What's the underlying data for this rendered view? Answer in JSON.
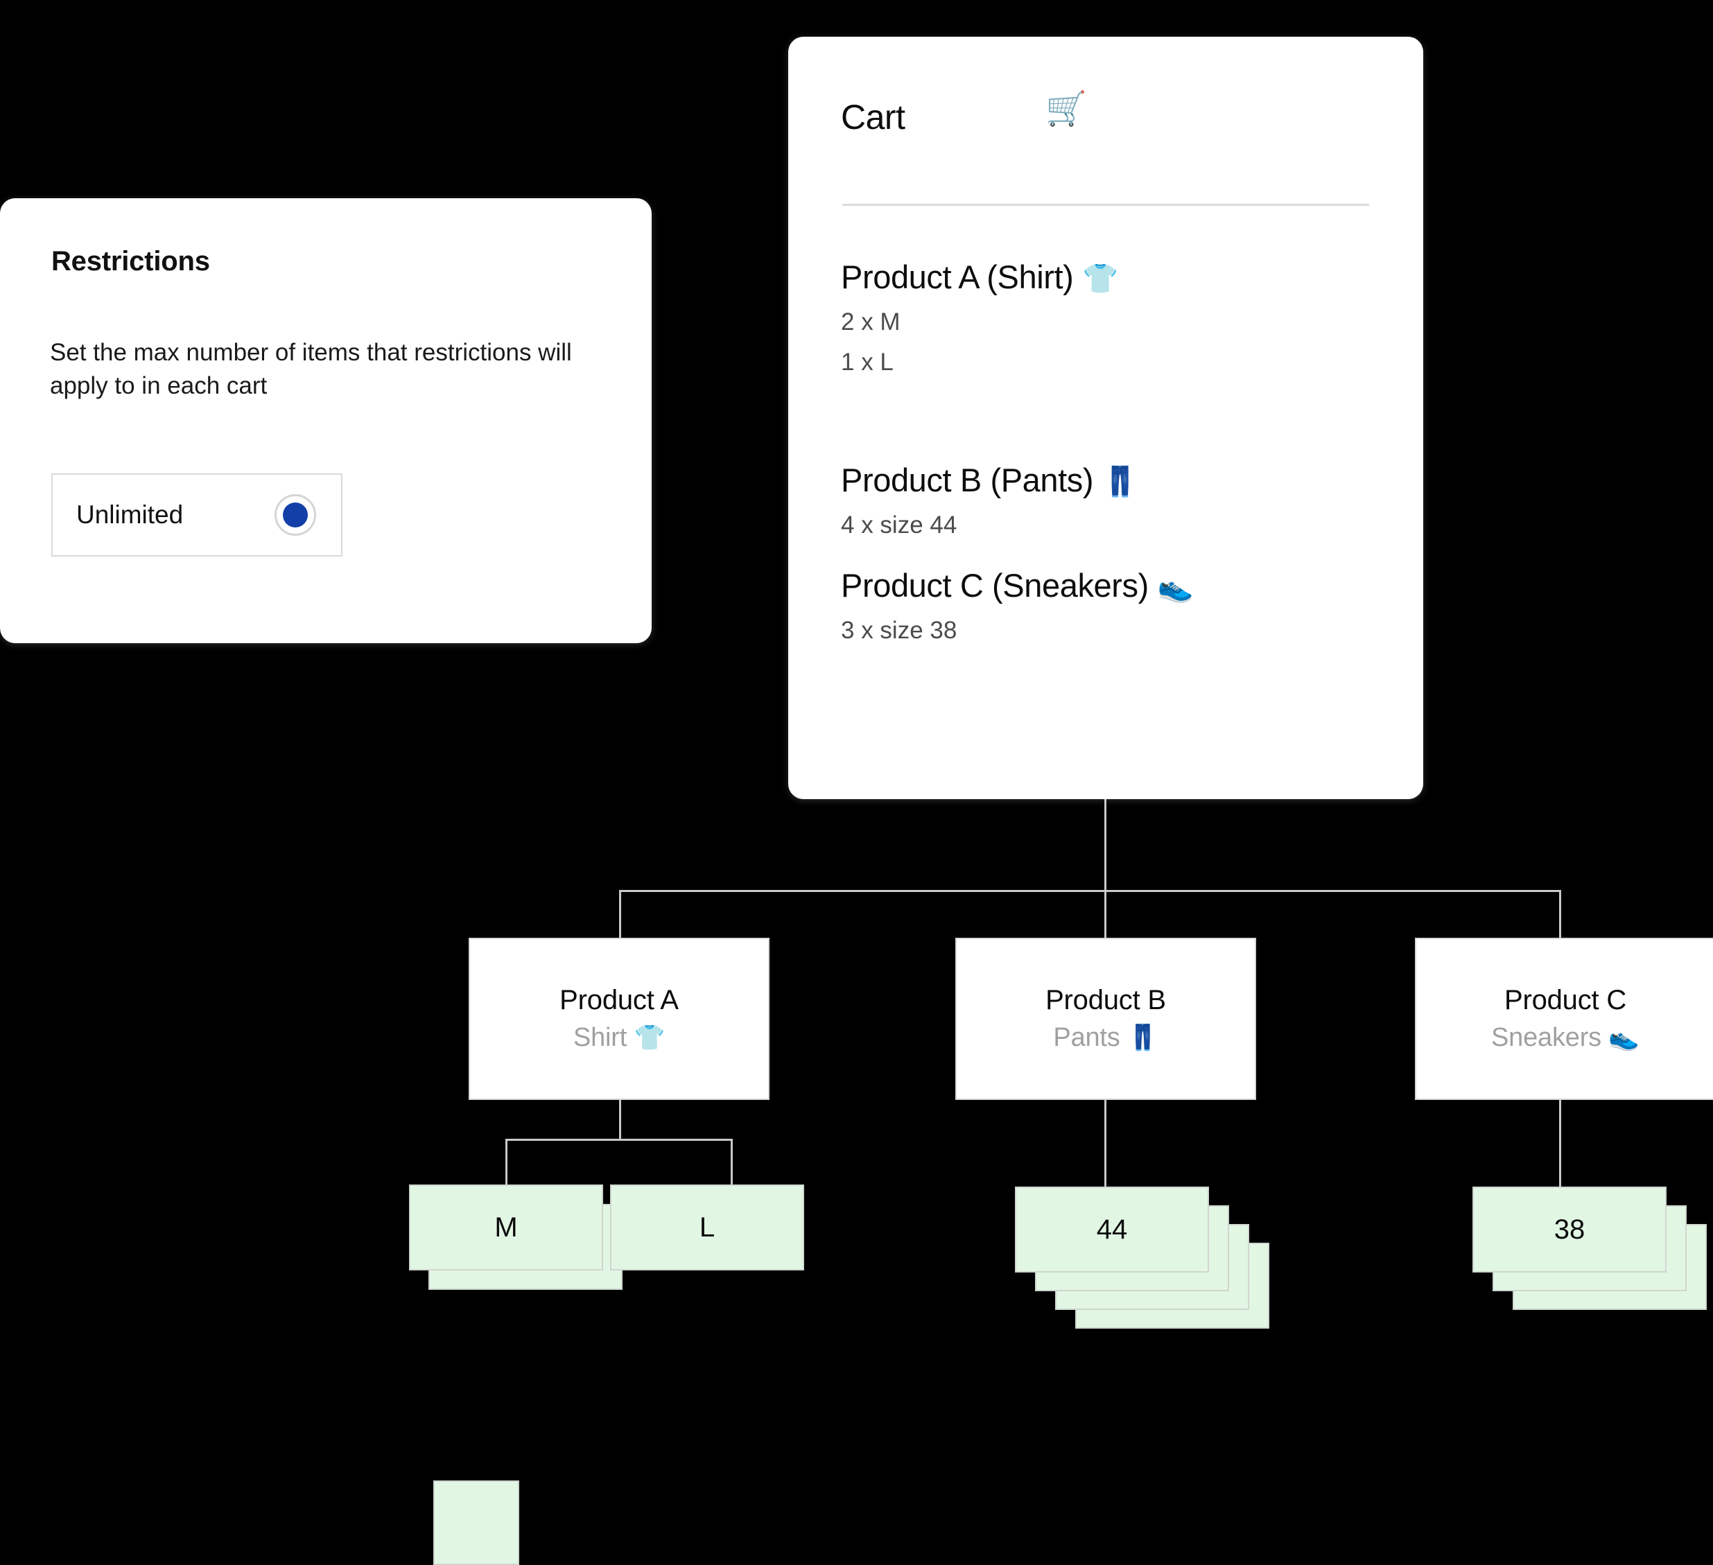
{
  "restrictions": {
    "title": "Restrictions",
    "description": "Set the max number of items  that restrictions will apply to in each cart",
    "option": {
      "label": "Unlimited",
      "selected": true,
      "radio_color": "#123fa8"
    }
  },
  "cart": {
    "title": "Cart",
    "icon": "shopping-cart-icon",
    "icon_glyph": "🛒",
    "items": [
      {
        "name": "Product A (Shirt)",
        "emoji": "👕",
        "quantities": [
          "2 x M",
          "1 x L"
        ]
      },
      {
        "name": "Product B (Pants)",
        "emoji": "👖",
        "quantities": [
          "4 x size 44"
        ]
      },
      {
        "name": "Product C (Sneakers)",
        "emoji": "👟",
        "quantities": [
          "3 x size 38"
        ]
      }
    ]
  },
  "tree": {
    "products": [
      {
        "title": "Product A",
        "subtitle": "Shirt",
        "emoji": "👕"
      },
      {
        "title": "Product B",
        "subtitle": "Pants",
        "emoji": "👖"
      },
      {
        "title": "Product C",
        "subtitle": "Sneakers",
        "emoji": "👟"
      }
    ],
    "variants": [
      {
        "label": "M",
        "count": 2,
        "parent": "Product A"
      },
      {
        "label": "L",
        "count": 1,
        "parent": "Product A"
      },
      {
        "label": "44",
        "count": 4,
        "parent": "Product B"
      },
      {
        "label": "38",
        "count": 3,
        "parent": "Product C"
      }
    ]
  },
  "colors": {
    "background": "#000000",
    "card": "#ffffff",
    "variant_card": "#e2f6e4",
    "variant_border": "#cfd6cf",
    "connector": "#c9c9c9",
    "muted_text": "#a0a0a0",
    "accent": "#123fa8"
  }
}
